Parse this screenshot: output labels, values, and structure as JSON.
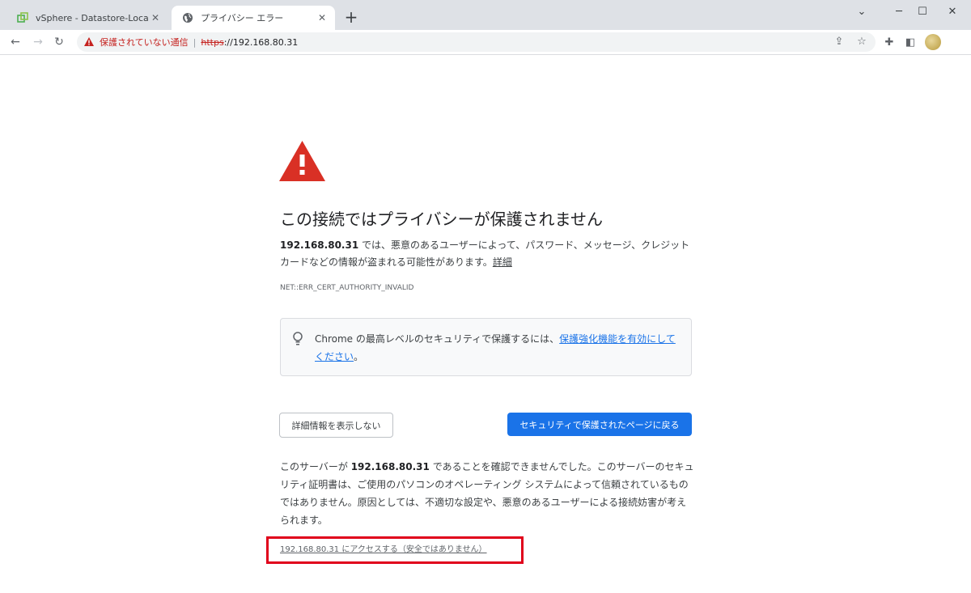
{
  "tabs": [
    {
      "title": "vSphere - Datastore-Local-VMFS",
      "active": false
    },
    {
      "title": "プライバシー エラー",
      "active": true
    }
  ],
  "toolbar": {
    "not_secure": "保護されていない通信",
    "scheme": "https",
    "url_rest": "://192.168.80.31"
  },
  "page": {
    "heading": "この接続ではプライバシーが保護されません",
    "desc_host": "192.168.80.31",
    "desc_text": " では、悪意のあるユーザーによって、パスワード、メッセージ、クレジット カードなどの情報が盗まれる可能性があります。",
    "desc_link": "詳細",
    "error_code": "NET::ERR_CERT_AUTHORITY_INVALID",
    "info_text": "Chrome の最高レベルのセキュリティで保護するには、",
    "info_link": "保護強化機能を有効にしてください",
    "info_end": "。",
    "btn_hide_details": "詳細情報を表示しない",
    "btn_back_safe": "セキュリティで保護されたページに戻る",
    "details_pre": "このサーバーが ",
    "details_host": "192.168.80.31",
    "details_post": " であることを確認できませんでした。このサーバーのセキュリティ証明書は、ご使用のパソコンのオペレーティング システムによって信頼されているものではありません。原因としては、不適切な設定や、悪意のあるユーザーによる接続妨害が考えられます。",
    "proceed_link": "192.168.80.31 にアクセスする（安全ではありません）"
  },
  "colors": {
    "warning_red": "#d93025",
    "primary_blue": "#1a73e8",
    "highlight_box": "#e0001b"
  }
}
